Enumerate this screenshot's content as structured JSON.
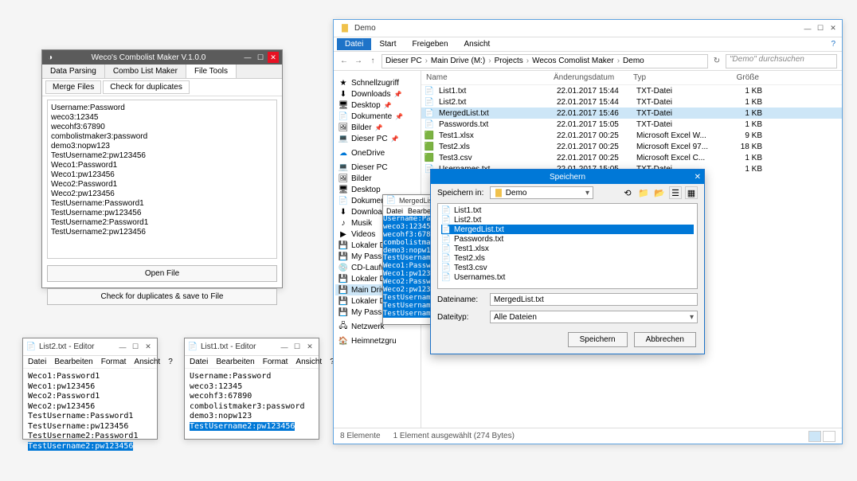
{
  "combolist": {
    "title": "Weco's Combolist Maker V.1.0.0",
    "tabs": [
      "Data Parsing",
      "Combo List Maker",
      "File Tools"
    ],
    "active_tab": 2,
    "subtabs": [
      "Merge Files",
      "Check for duplicates"
    ],
    "active_subtab": 0,
    "content": "Username:Password\nweco3:12345\nwecohf3:67890\ncombolistmaker3:password\ndemo3:nopw123\nTestUsername2:pw123456\nWeco1:Password1\nWeco1:pw123456\nWeco2:Password1\nWeco2:pw123456\nTestUsername:Password1\nTestUsername:pw123456\nTestUsername2:Password1\nTestUsername2:pw123456",
    "btn_open": "Open File",
    "btn_dup": "Check for duplicates & save to File"
  },
  "notepad1": {
    "title": "List2.txt - Editor",
    "menu": [
      "Datei",
      "Bearbeiten",
      "Format",
      "Ansicht",
      "?"
    ],
    "lines": [
      "Weco1:Password1",
      "Weco1:pw123456",
      "Weco2:Password1",
      "Weco2:pw123456",
      "TestUsername:Password1",
      "TestUsername:pw123456",
      "TestUsername2:Password1"
    ],
    "selected_line": "TestUsername2:pw123456"
  },
  "notepad2": {
    "title": "List1.txt - Editor",
    "menu": [
      "Datei",
      "Bearbeiten",
      "Format",
      "Ansicht",
      "?"
    ],
    "lines": [
      "Username:Password",
      "weco3:12345",
      "wecohf3:67890",
      "combolistmaker3:password",
      "demo3:nopw123"
    ],
    "selected_line": "TestUsername2:pw123456"
  },
  "explorer": {
    "folder_name": "Demo",
    "ribbon": [
      "Datei",
      "Start",
      "Freigeben",
      "Ansicht"
    ],
    "breadcrumbs": [
      "Dieser PC",
      "Main Drive (M:)",
      "Projects",
      "Wecos Comolist Maker",
      "Demo"
    ],
    "search_placeholder": "\"Demo\" durchsuchen",
    "columns": [
      "Name",
      "Änderungsdatum",
      "Typ",
      "Größe"
    ],
    "nav": {
      "quick": "Schnellzugriff",
      "quick_items": [
        "Downloads",
        "Desktop",
        "Dokumente",
        "Bilder",
        "Dieser PC"
      ],
      "onedrive": "OneDrive",
      "dieser_pc": "Dieser PC",
      "pc_items": [
        "Bilder",
        "Desktop",
        "Dokumente",
        "Downloads",
        "Musik",
        "Videos",
        "Lokaler Dat",
        "My Passport",
        "CD-Laufwe",
        "Lokaler Dat",
        "Main Drive",
        "Lokaler Date",
        "My Passport"
      ],
      "netzwerk": "Netzwerk",
      "heimnetz": "Heimnetzgru"
    },
    "files": [
      {
        "name": "List1.txt",
        "date": "22.01.2017 15:44",
        "type": "TXT-Datei",
        "size": "1 KB",
        "icon": "txt"
      },
      {
        "name": "List2.txt",
        "date": "22.01.2017 15:44",
        "type": "TXT-Datei",
        "size": "1 KB",
        "icon": "txt"
      },
      {
        "name": "MergedList.txt",
        "date": "22.01.2017 15:46",
        "type": "TXT-Datei",
        "size": "1 KB",
        "icon": "txt",
        "selected": true
      },
      {
        "name": "Passwords.txt",
        "date": "22.01.2017 15:05",
        "type": "TXT-Datei",
        "size": "1 KB",
        "icon": "txt"
      },
      {
        "name": "Test1.xlsx",
        "date": "22.01.2017 00:25",
        "type": "Microsoft Excel W...",
        "size": "9 KB",
        "icon": "xls"
      },
      {
        "name": "Test2.xls",
        "date": "22.01.2017 00:25",
        "type": "Microsoft Excel 97...",
        "size": "18 KB",
        "icon": "xls"
      },
      {
        "name": "Test3.csv",
        "date": "22.01.2017 00:25",
        "type": "Microsoft Excel C...",
        "size": "1 KB",
        "icon": "xls"
      },
      {
        "name": "Usernames.txt",
        "date": "22.01.2017 15:05",
        "type": "TXT-Datei",
        "size": "1 KB",
        "icon": "txt"
      }
    ],
    "status_items": "8 Elemente",
    "status_sel": "1 Element ausgewählt (274 Bytes)"
  },
  "mini_editor": {
    "title": "MergedList.txt",
    "menu": [
      "Datei",
      "Bearbeiten"
    ],
    "lines": [
      "Username:Pass",
      "weco3:12345",
      "wecohf3:67890",
      "combolistmak",
      "demo3:nopw12",
      "TestUsername",
      "Weco1:Passwo",
      "Weco1:pw1234",
      "Weco2:Passwo",
      "Weco2:pw1234",
      "TestUsername",
      "TestUsername",
      "TestUsername2"
    ]
  },
  "save_dialog": {
    "title": "Speichern",
    "label_savein": "Speichern in:",
    "savein_value": "Demo",
    "listing": [
      {
        "name": "List1.txt"
      },
      {
        "name": "List2.txt"
      },
      {
        "name": "MergedList.txt",
        "selected": true
      },
      {
        "name": "Passwords.txt"
      },
      {
        "name": "Test1.xlsx"
      },
      {
        "name": "Test2.xls"
      },
      {
        "name": "Test3.csv"
      },
      {
        "name": "Usernames.txt"
      }
    ],
    "label_filename": "Dateiname:",
    "filename_value": "MergedList.txt",
    "label_filetype": "Dateityp:",
    "filetype_value": "Alle Dateien",
    "btn_save": "Speichern",
    "btn_cancel": "Abbrechen"
  }
}
